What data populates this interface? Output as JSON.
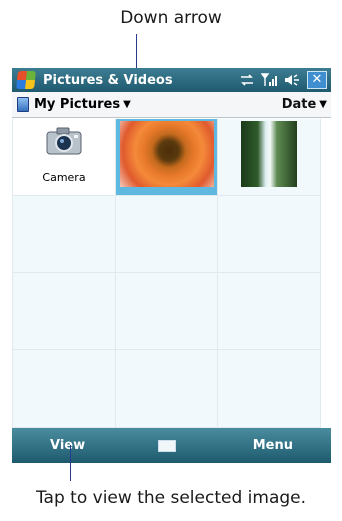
{
  "callouts": {
    "top": "Down arrow",
    "bottom": "Tap to view the selected image."
  },
  "title_bar": {
    "app_title": "Pictures & Videos",
    "icons": [
      "windows-start-icon",
      "connectivity-icon",
      "signal-icon",
      "volume-icon",
      "close-icon"
    ],
    "close_label": "✕"
  },
  "folder_bar": {
    "folder_name": "My Pictures",
    "sort_label": "Date"
  },
  "items": [
    {
      "type": "folder",
      "label": "Camera",
      "icon": "camera-icon"
    },
    {
      "type": "image",
      "subject": "flower",
      "selected": true
    },
    {
      "type": "image",
      "subject": "waterfall",
      "selected": false
    }
  ],
  "soft_keys": {
    "left": "View",
    "center_icon": "keyboard-icon",
    "right": "Menu"
  },
  "colors": {
    "title_bar": "#2a6a80",
    "soft_bar": "#2f7083",
    "selection": "#5fb8df",
    "callout_lines": "#2a3a8a"
  }
}
